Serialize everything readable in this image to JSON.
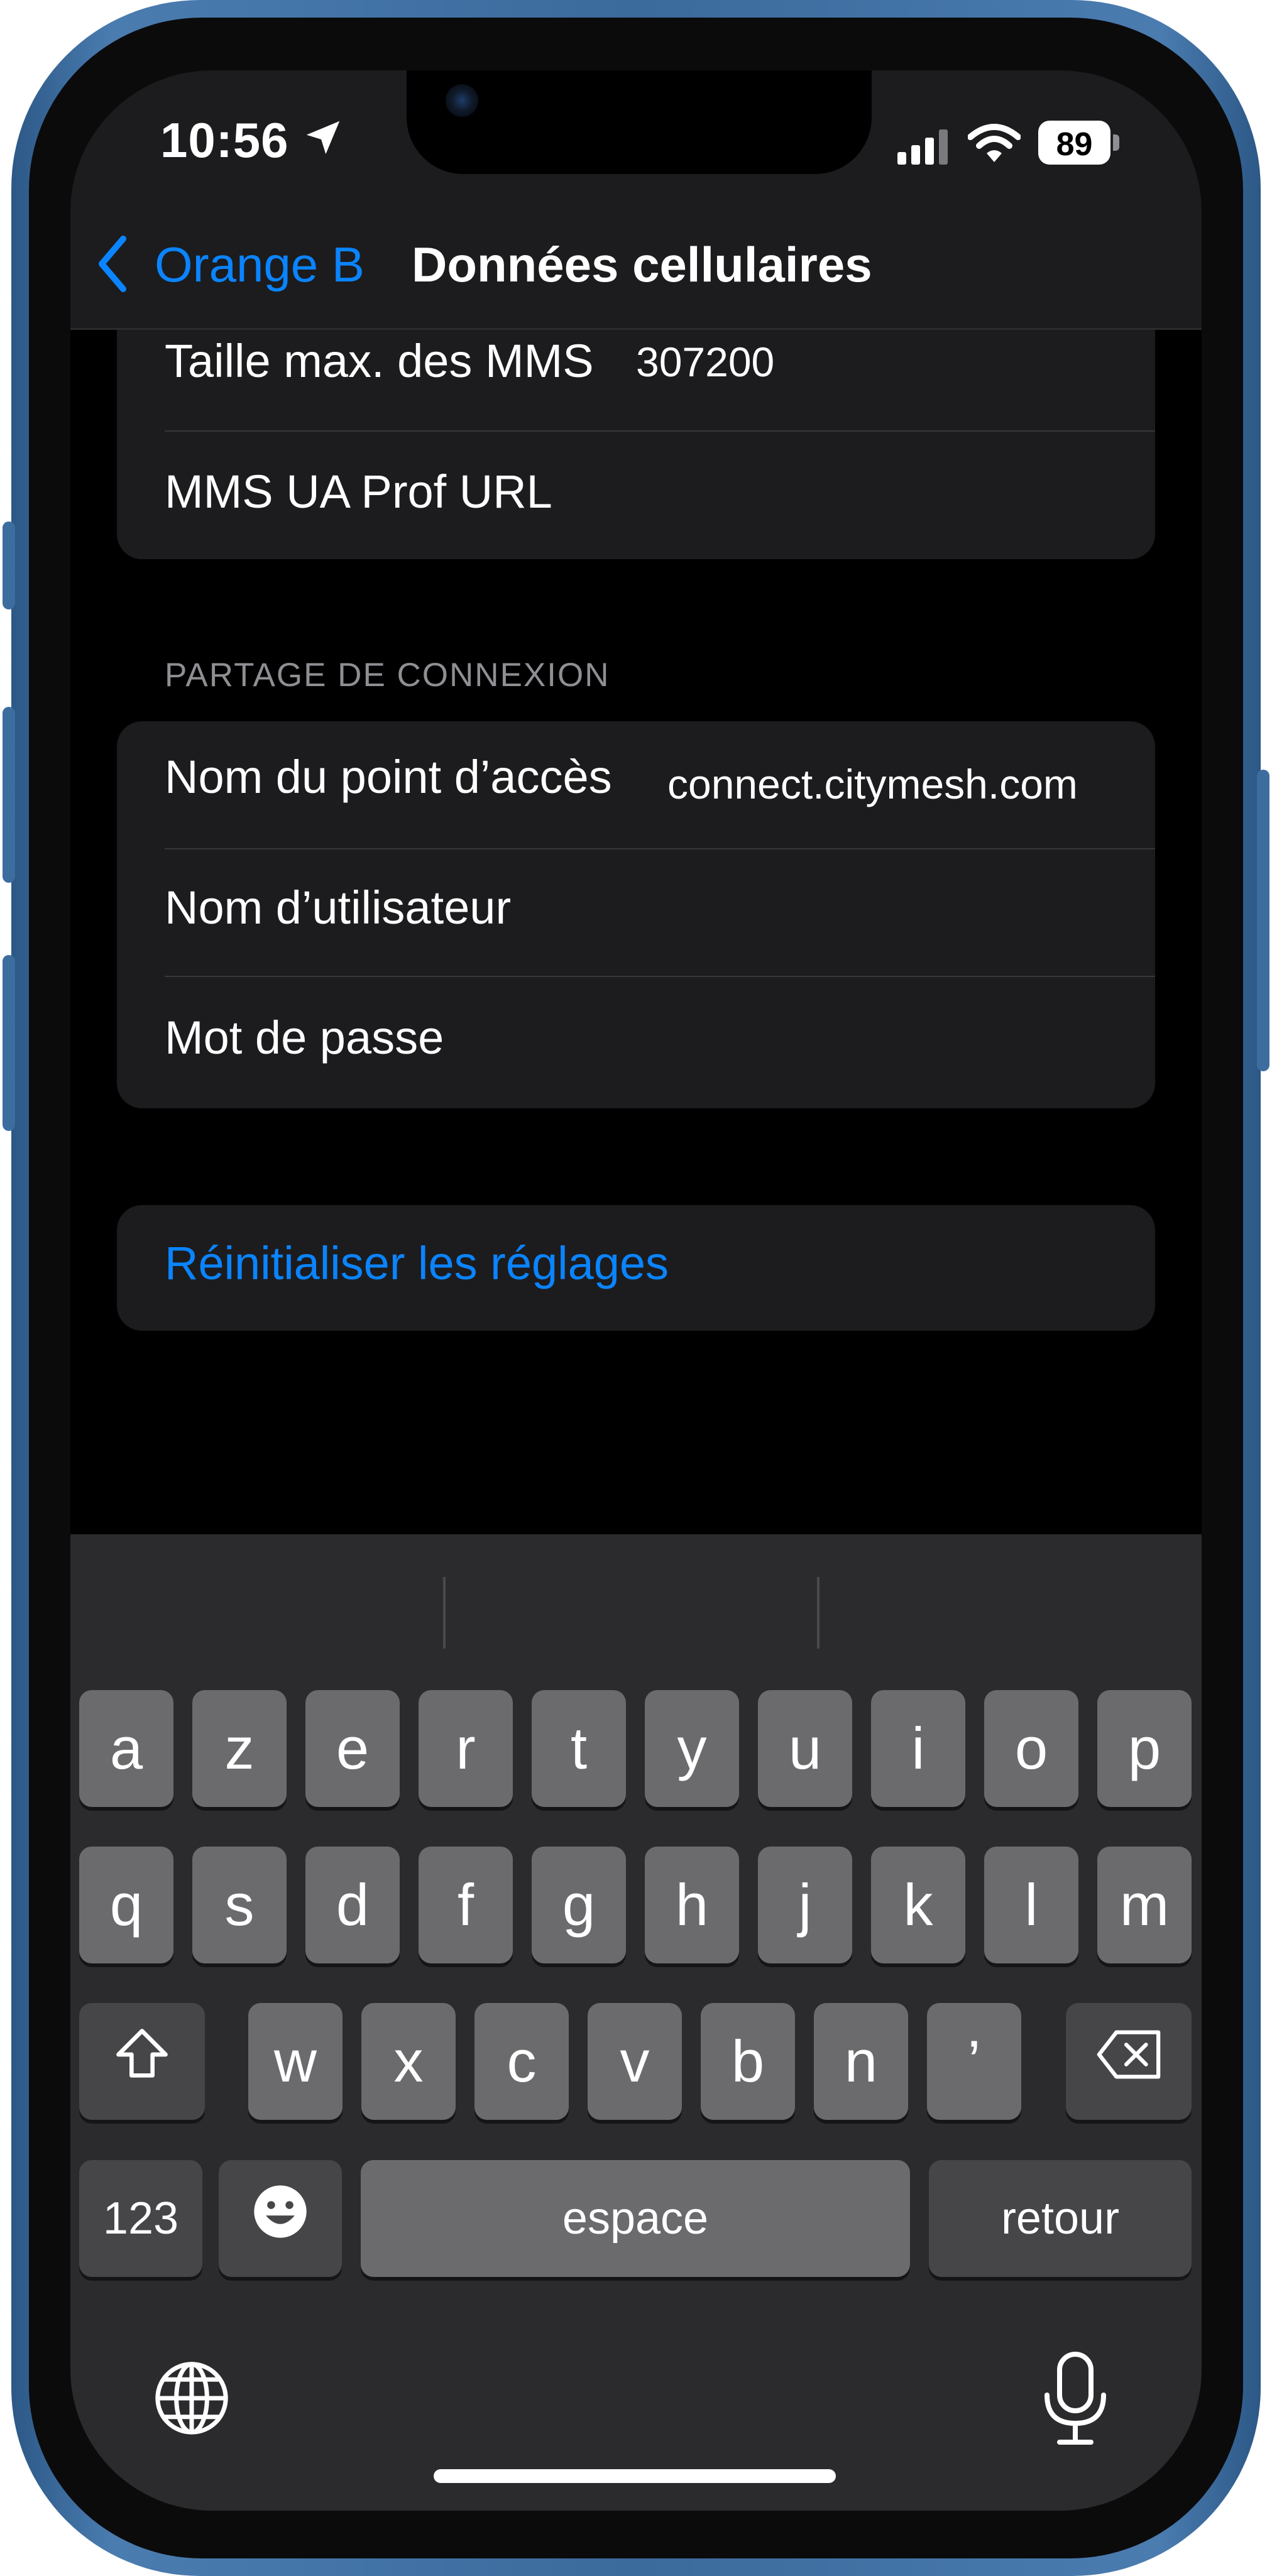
{
  "status_bar": {
    "time": "10:56",
    "battery": "89",
    "icons": [
      "location-arrow-icon",
      "cellular-signal-icon",
      "wifi-icon",
      "battery-icon"
    ]
  },
  "nav": {
    "back_label": "Orange B",
    "title": "Données cellulaires"
  },
  "mms_group": {
    "rows": [
      {
        "label": "Taille max. des MMS",
        "value": "307200"
      },
      {
        "label": "MMS UA Prof URL",
        "value": ""
      }
    ]
  },
  "hotspot_section": {
    "header": "PARTAGE DE CONNEXION",
    "rows": [
      {
        "label": "Nom du point d’accès",
        "value": "connect.citymesh.com"
      },
      {
        "label": "Nom d’utilisateur",
        "value": ""
      },
      {
        "label": "Mot de passe",
        "value": ""
      }
    ]
  },
  "reset": {
    "label": "Réinitialiser les réglages"
  },
  "keyboard": {
    "row1": [
      "a",
      "z",
      "e",
      "r",
      "t",
      "y",
      "u",
      "i",
      "o",
      "p"
    ],
    "row2": [
      "q",
      "s",
      "d",
      "f",
      "g",
      "h",
      "j",
      "k",
      "l",
      "m"
    ],
    "row3": [
      "w",
      "x",
      "c",
      "v",
      "b",
      "n",
      "’"
    ],
    "numbers_key": "123",
    "space_key": "espace",
    "return_key": "retour",
    "icons": [
      "shift-icon",
      "delete-icon",
      "emoji-icon",
      "globe-icon",
      "microphone-icon"
    ]
  },
  "colors": {
    "accent": "#0a84ff",
    "frame": "#3b6a9c",
    "background": "#000000",
    "group": "#1c1c1e",
    "key": "#6b6b6e",
    "function_key": "#464649"
  }
}
